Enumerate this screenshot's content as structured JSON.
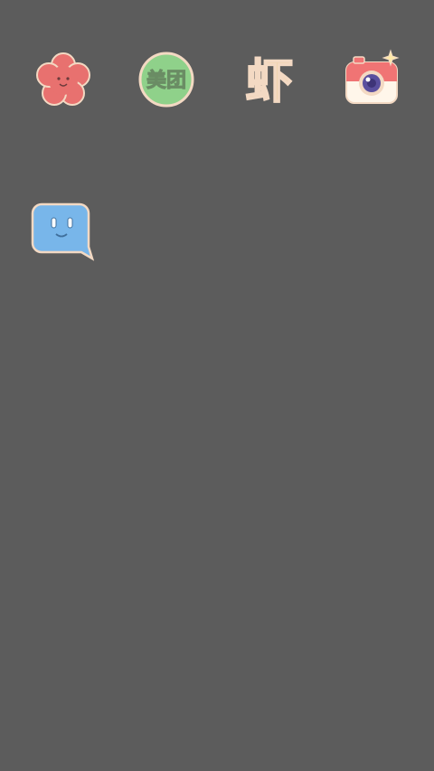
{
  "home_screen": {
    "apps": [
      {
        "id": "flower",
        "icon": "flower-icon",
        "label": "",
        "color": "#e8716f"
      },
      {
        "id": "meituan",
        "icon": "meituan-icon",
        "label": "",
        "glyphs": "美团",
        "color": "#8fd18a"
      },
      {
        "id": "xia",
        "icon": "xia-glyph-icon",
        "label": "",
        "glyphs": "虾",
        "color": "#e8bf63"
      },
      {
        "id": "camera",
        "icon": "camera-icon",
        "label": "",
        "color": "#f07474"
      },
      {
        "id": "chat",
        "icon": "chat-bubble-icon",
        "label": "",
        "color": "#78b6ea"
      }
    ]
  },
  "glyphs": {
    "meituan": "美团",
    "xia": "虾"
  },
  "colors": {
    "wallpaper": "#5c5c5c",
    "outline": "#f3d9c3"
  }
}
